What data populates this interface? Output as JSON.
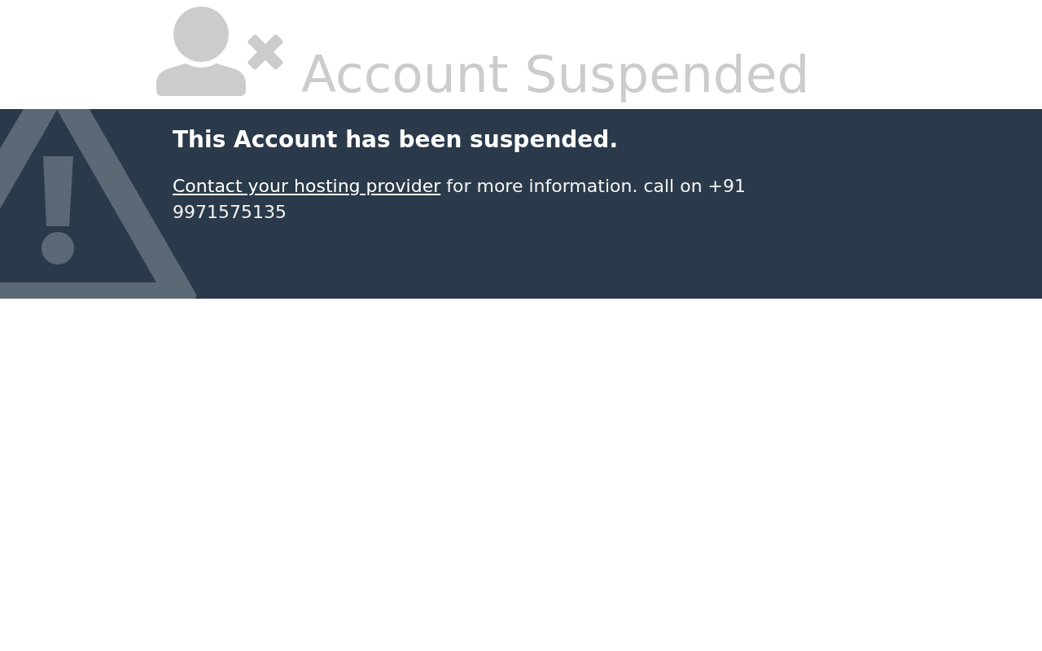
{
  "header": {
    "title": "Account Suspended"
  },
  "notice": {
    "heading": "This Account has been suspended.",
    "link": "Contact your hosting provider",
    "message": "for more information. call on +91 9971575135"
  }
}
